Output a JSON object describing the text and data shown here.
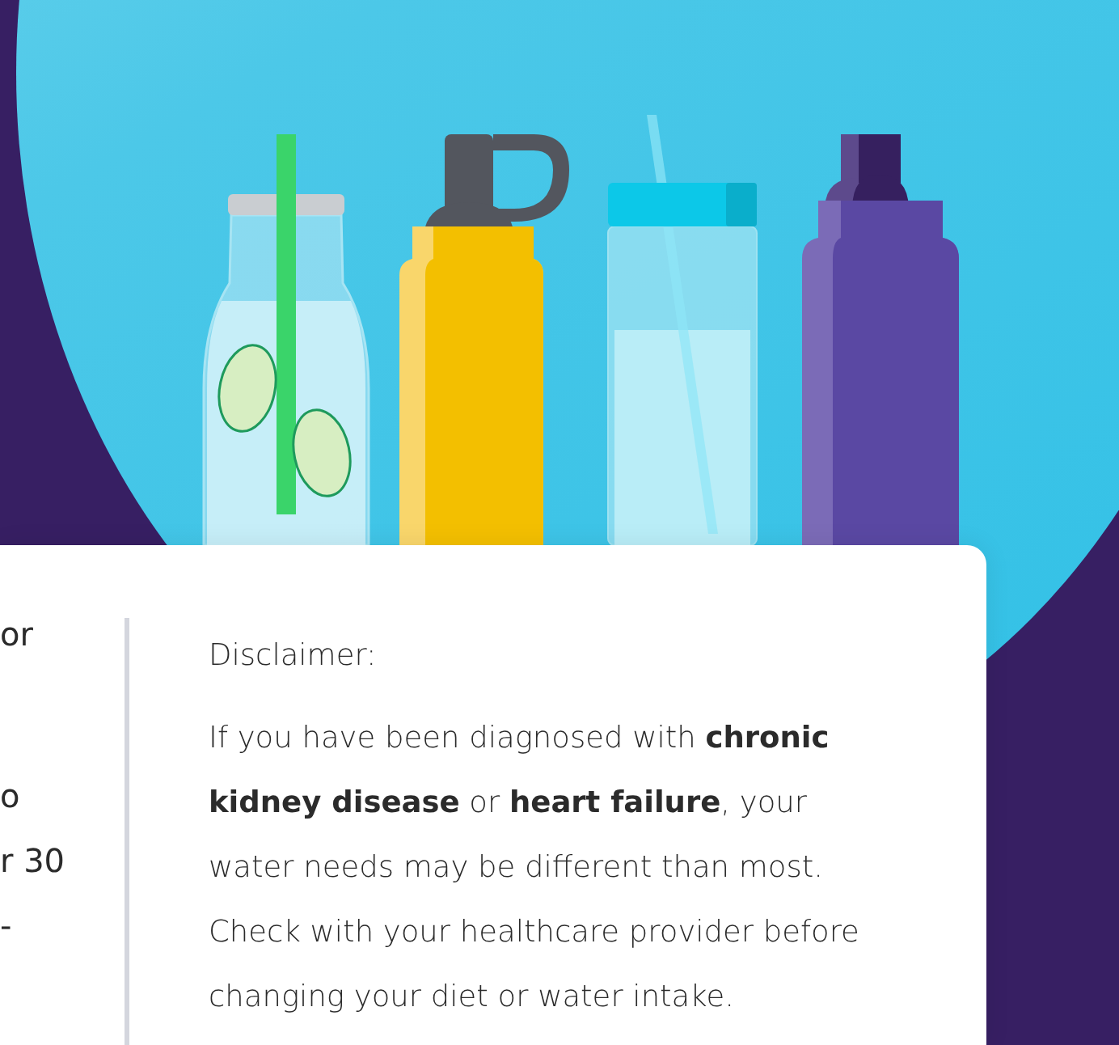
{
  "left_column": {
    "lines": [
      "or",
      "o",
      "r 30",
      "-"
    ]
  },
  "disclaimer": {
    "heading": "Disclaimer:",
    "body": "If you have been diagnosed with **chronic kidney disease** or **heart failure**, your water needs may be different than most. Check with your healthcare provider before changing your diet or water intake."
  }
}
